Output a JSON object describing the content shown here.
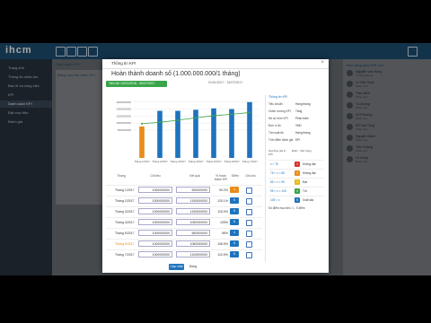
{
  "app": {
    "logo": "ihcm"
  },
  "sidebar": {
    "items": [
      {
        "label": "Trang chủ"
      },
      {
        "label": "Thông tin nhân lực"
      },
      {
        "label": "Bán lẻ và công việc"
      },
      {
        "label": "KPI"
      },
      {
        "label": "Danh sách KPI"
      },
      {
        "label": "Đặt mục tiêu"
      },
      {
        "label": "Đánh giá"
      }
    ]
  },
  "background": {
    "breadcrumb": "Danh sách KPI",
    "section": "Bảng mục tiêu theo KPI"
  },
  "right_panel": {
    "title": "Bạn đang giao KPI cho",
    "users": [
      {
        "name": "Nguyễn Văn Hùng",
        "sub": "Trưởng phòng"
      },
      {
        "name": "Lê Văn Hạnh",
        "sub": "Nhân viên"
      },
      {
        "name": "Trần Minh",
        "sub": "Nhân viên"
      },
      {
        "name": "Tạ Quang",
        "sub": "Nhân viên"
      },
      {
        "name": "Võ Phương",
        "sub": "Nhân viên"
      },
      {
        "name": "Đỗ Văn Tùng",
        "sub": "Nhân viên"
      },
      {
        "name": "Nguyễn Mạnh",
        "sub": "Nhân viên"
      },
      {
        "name": "Trần Hoàng",
        "sub": "Nhân viên"
      },
      {
        "name": "Lê Hùng",
        "sub": "Nhân viên"
      }
    ]
  },
  "modal": {
    "title": "Thông tin KPI",
    "close": "×",
    "heading": "Hoàn thành doanh số (1.000.000.000/1 tháng)",
    "period_button": "Tiến độ: 01/01/2016 - 30/07/2017",
    "date_range": "01/01/2017 - 31/07/2017",
    "update_button": "Cập nhật",
    "close_button": "Đóng"
  },
  "chart_data": {
    "type": "bar",
    "categories": [
      "Tháng 1/2017",
      "Tháng 2/2017",
      "Tháng 3/2017",
      "Tháng 4/2017",
      "Tháng 5/2017",
      "Tháng 6/2017",
      "Tháng 7/2017"
    ],
    "series": [
      {
        "values": [
          900000000,
          1350000000,
          1350000000,
          1380000000,
          1420000000,
          1400000000,
          1600000000
        ],
        "colors": [
          "#e88c1a",
          "#1e73be",
          "#1e73be",
          "#1e73be",
          "#1e73be",
          "#1e73be",
          "#1e73be"
        ]
      },
      {
        "values": [
          980000000,
          1020000000,
          1080000000,
          1150000000,
          1210000000,
          1250000000,
          1300000000
        ],
        "type": "line",
        "color": "#3aa54a"
      }
    ],
    "yticks": [
      "1600000000",
      "1400000000",
      "1200000000",
      "1000000000",
      "800000000"
    ],
    "ylim": [
      0,
      1800000000
    ],
    "grid": true
  },
  "table": {
    "headers": [
      "Tháng",
      "Chỉ tiêu",
      "Kết quả",
      "% Hoàn thành KPI",
      "Điểm",
      "Ghi chú"
    ],
    "rows": [
      {
        "month": "Tháng 1/2017",
        "target": "1000000000",
        "result": "900000000",
        "pct": "90.2%",
        "score": "1",
        "score_color": "#e88c1a",
        "highlight": false
      },
      {
        "month": "Tháng 2/2017",
        "target": "1000000000",
        "result": "1150000000",
        "pct": "115.1%",
        "score": "5",
        "score_color": "#1e73be",
        "highlight": false
      },
      {
        "month": "Tháng 3/2017",
        "target": "1000000000",
        "result": "1150000000",
        "pct": "115.0%",
        "score": "5",
        "score_color": "#1e73be",
        "highlight": false
      },
      {
        "month": "Tháng 4/2017",
        "target": "1000000000",
        "result": "1050000000",
        "pct": "105%",
        "score": "5",
        "score_color": "#1e73be",
        "highlight": false
      },
      {
        "month": "Tháng 5/2017",
        "target": "1000000000",
        "result": "960000000",
        "pct": "96%",
        "score": "4",
        "score_color": "#1e73be",
        "highlight": false
      },
      {
        "month": "Tháng 6/2017",
        "target": "1000000000",
        "result": "1060000000",
        "pct": "106.5%",
        "score": "5",
        "score_color": "#1e73be",
        "highlight": true
      },
      {
        "month": "Tháng 7/2017",
        "target": "1000000000",
        "result": "1100000000",
        "pct": "110.5%",
        "score": "5",
        "score_color": "#1e73be",
        "highlight": false
      }
    ]
  },
  "info": {
    "heading": "Thông tin KPI",
    "rows": [
      {
        "k": "Tiêu chuẩn",
        "v": "Hàng tháng"
      },
      {
        "k": "Chiều hướng KPI",
        "v": "Tăng"
      },
      {
        "k": "Hệ số mức KPI",
        "v": "Phần trăm"
      },
      {
        "k": "Đơn vị đo",
        "v": "VND"
      },
      {
        "k": "Tần suất đo",
        "v": "Hàng tháng"
      },
      {
        "k": "Tính điểm đánh giá",
        "v": "KPI"
      }
    ],
    "level_headers": [
      "Ngưỡng giá trị KPI",
      "Điểm",
      "Xếp hạng"
    ],
    "levels": [
      {
        "range": "x < 75",
        "score": "1",
        "color": "#d9332b",
        "rank": "Không đạt"
      },
      {
        "range": "75 < x < 85",
        "score": "2",
        "color": "#e88c1a",
        "rank": "Không đạt"
      },
      {
        "range": "85 < x < 95",
        "score": "3",
        "color": "#e8b91a",
        "rank": "Đạt"
      },
      {
        "range": "95 < x < 105",
        "score": "4",
        "color": "#3aa54a",
        "rank": "Tốt"
      },
      {
        "range": "105 < x",
        "score": "5",
        "color": "#1e73be",
        "rank": "Xuất sắc"
      }
    ],
    "footer": "Số điểm mục tiêu: 1 - 5 điểm"
  }
}
